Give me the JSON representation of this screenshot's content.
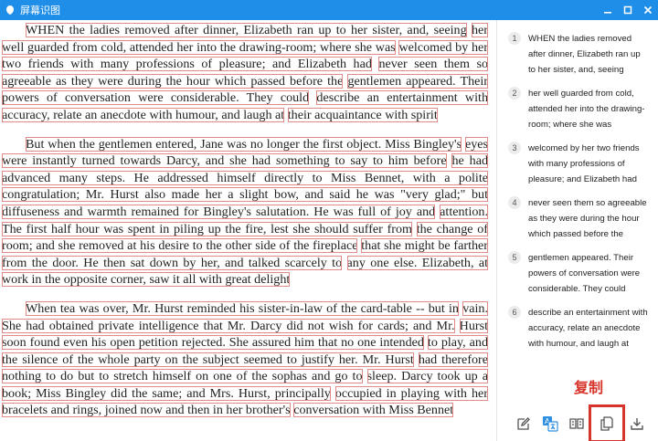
{
  "window": {
    "title": "屏幕识图"
  },
  "document": {
    "paragraphs": [
      [
        "WHEN the ladies removed after dinner, Elizabeth ran up to her sister, and, seeing",
        "her well guarded from cold, attended her into the drawing-room; where she was",
        "welcomed by her two friends with many professions of pleasure; and Elizabeth had",
        "never seen them so agreeable as they were during the hour which passed before the",
        "gentlemen appeared. Their powers of conversation were considerable. They could",
        "describe an entertainment with accuracy, relate an anecdote with humour, and laugh at",
        "their acquaintance with spirit"
      ],
      [
        "But when the gentlemen entered, Jane was no longer the first object. Miss Bingley's",
        "eyes were instantly turned towards Darcy, and she had something to say to him before",
        "he had advanced many steps. He addressed himself directly to Miss Bennet, with a polite",
        "congratulation; Mr. Hurst also made her a slight bow, and said he was \"very glad;\" but",
        "diffuseness and warmth remained for Bingley's salutation. He was full of joy and",
        "attention. The first half hour was spent in piling up the fire, lest she should suffer from",
        "the change of room; and she removed at his desire to the other side of the fireplace",
        "that she might be farther from the door. He then sat down by her, and talked scarcely to",
        "any one else. Elizabeth, at work in the opposite corner, saw it all with great delight"
      ],
      [
        "When tea was over, Mr. Hurst reminded his sister-in-law of the card-table -- but in",
        "vain. She had obtained private intelligence that Mr. Darcy did not wish for cards; and Mr.",
        "Hurst soon found even his open petition rejected. She assured him that no one intended",
        "to play, and the silence of the whole party on the subject seemed to justify her. Mr. Hurst",
        "had therefore nothing to do but to stretch himself on one of the sophas and go to",
        "sleep. Darcy took up a book; Miss Bingley did the same; and Mrs. Hurst, principally",
        "occupied in playing with her bracelets and rings, joined now and then in her brother's",
        "conversation with Miss Bennet"
      ]
    ]
  },
  "results": [
    {
      "num": "1",
      "text": "WHEN the ladies removed after dinner, Elizabeth ran up to her sister, and, seeing"
    },
    {
      "num": "2",
      "text": "her well guarded from cold, attended her into the drawing-room; where she was"
    },
    {
      "num": "3",
      "text": "welcomed by her two friends with many professions of pleasure; and Elizabeth had"
    },
    {
      "num": "4",
      "text": "never seen them so agreeable as they were during the hour which passed before the"
    },
    {
      "num": "5",
      "text": "gentlemen appeared. Their powers of conversation were considerable. They could"
    },
    {
      "num": "6",
      "text": "describe an entertainment with accuracy, relate an anecdote with humour, and laugh at"
    }
  ],
  "callout": {
    "copy_label": "复制"
  },
  "toolbar": {
    "icons": [
      "edit-icon",
      "translate-icon",
      "read-aloud-icon",
      "copy-icon",
      "download-icon"
    ]
  },
  "colors": {
    "titlebar": "#1f8ee8",
    "ocr_box": "#e08a8a",
    "highlight": "#d7342b"
  }
}
